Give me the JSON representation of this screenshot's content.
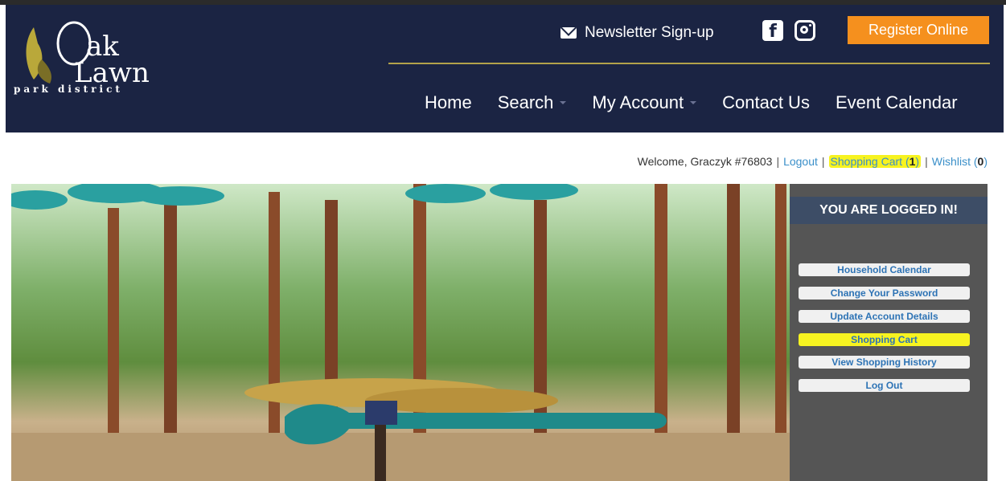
{
  "header": {
    "logo_text": "park district",
    "newsletter": "Newsletter Sign-up",
    "register": "Register Online",
    "nav": [
      {
        "label": "Home",
        "caret": false
      },
      {
        "label": "Search",
        "caret": true
      },
      {
        "label": "My Account",
        "caret": true
      },
      {
        "label": "Contact Us",
        "caret": false
      },
      {
        "label": "Event Calendar",
        "caret": false
      }
    ]
  },
  "welcome": {
    "greeting": "Welcome, Graczyk #76803",
    "logout": "Logout",
    "cart_label": "Shopping Cart",
    "cart_count": "1",
    "wishlist_label": "Wishlist",
    "wishlist_count": "0"
  },
  "panel": {
    "title": "YOU ARE LOGGED IN!",
    "buttons": [
      {
        "label": "Household Calendar",
        "highlight": false
      },
      {
        "label": "Change Your Password",
        "highlight": false
      },
      {
        "label": "Update Account Details",
        "highlight": false
      },
      {
        "label": "Shopping Cart",
        "highlight": true
      },
      {
        "label": "View Shopping History",
        "highlight": false
      },
      {
        "label": "Log Out",
        "highlight": false
      }
    ]
  },
  "colors": {
    "header_bg": "#1b2443",
    "accent": "#f5901e",
    "highlight": "#f7f320"
  }
}
